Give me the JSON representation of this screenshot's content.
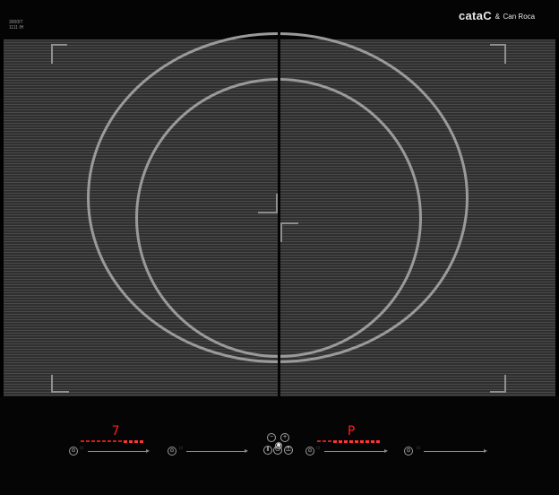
{
  "brand": {
    "logo_text": "cata",
    "logo_mark": "C",
    "amp": "&",
    "partner": "Can Roca",
    "model_mark": [
      "3000IT",
      "1111 IH"
    ]
  },
  "left_zone": {
    "power_level": "7",
    "slider_segments": 12,
    "slider_lit_segments": 4
  },
  "right_zone": {
    "power_level": "P",
    "slider_segments": 12,
    "slider_lit_segments": 9
  },
  "controls": {
    "minus_symbol": "−",
    "plus_symbol": "+",
    "timer_symbol": "⌚",
    "power_symbol": "⏻",
    "lock_symbol": "⚿",
    "pause_symbol": "Ⅱ",
    "arrow_symbol": "▸",
    "zone_select_symbol": "⊙"
  },
  "colors": {
    "display_red": "#ff2020",
    "glass_black": "#050505",
    "zone_ring_grey": "#9a9a9a"
  }
}
